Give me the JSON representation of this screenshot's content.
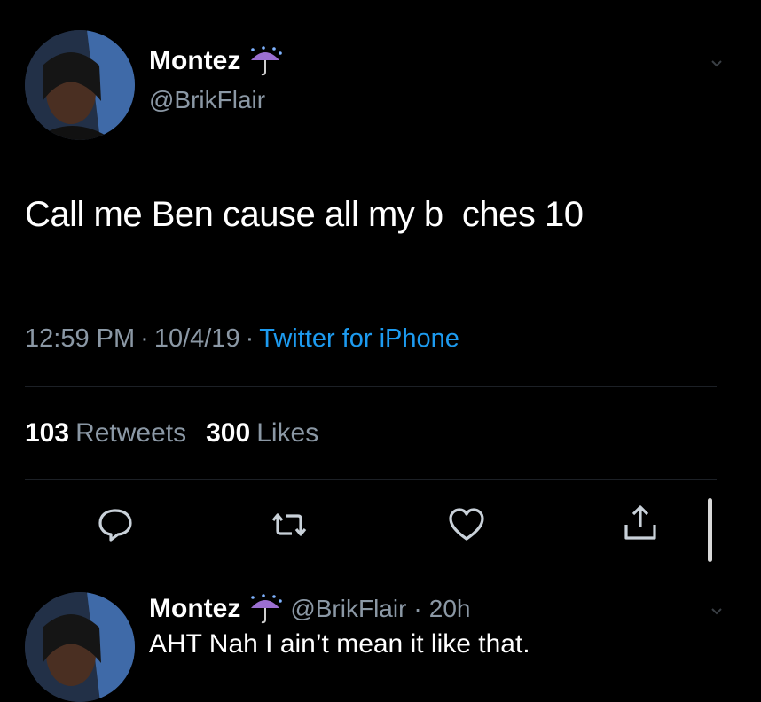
{
  "tweet": {
    "author": {
      "name": "Montez",
      "handle": "@BrikFlair",
      "name_emoji_icon": "umbrella-with-rain-icon"
    },
    "text": "Call me Ben cause all my b  ches 10",
    "time": "12:59 PM",
    "date": "10/4/19",
    "source": "Twitter for iPhone",
    "meta_separator": "·",
    "retweets": {
      "count": "103",
      "label": "Retweets"
    },
    "likes": {
      "count": "300",
      "label": "Likes"
    },
    "actions": [
      "reply-icon",
      "retweet-icon",
      "like-icon",
      "share-icon"
    ]
  },
  "reply": {
    "name": "Montez",
    "handle": "@BrikFlair",
    "separator": "·",
    "age": "20h",
    "text": "AHT Nah I ain’t mean it like that."
  },
  "colors": {
    "background": "#000000",
    "primary_text": "#ffffff",
    "secondary_text": "#8b98a5",
    "link": "#1d9bf0",
    "divider": "#1c2026"
  }
}
